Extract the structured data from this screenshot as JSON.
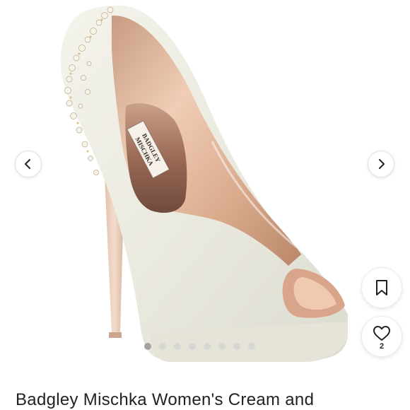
{
  "gallery": {
    "image_alt": "Badgley Mischka Women's Cream and",
    "brand_print": [
      "BADGLEY",
      "MISCHKA"
    ],
    "slide_count": 8,
    "active_slide": 1
  },
  "actions": {
    "like_count": "2"
  },
  "product": {
    "title": "Badgley Mischka Women's Cream and"
  },
  "icons": {
    "prev": "chevron-left-icon",
    "next": "chevron-right-icon",
    "save": "bookmark-icon",
    "like": "heart-icon"
  }
}
